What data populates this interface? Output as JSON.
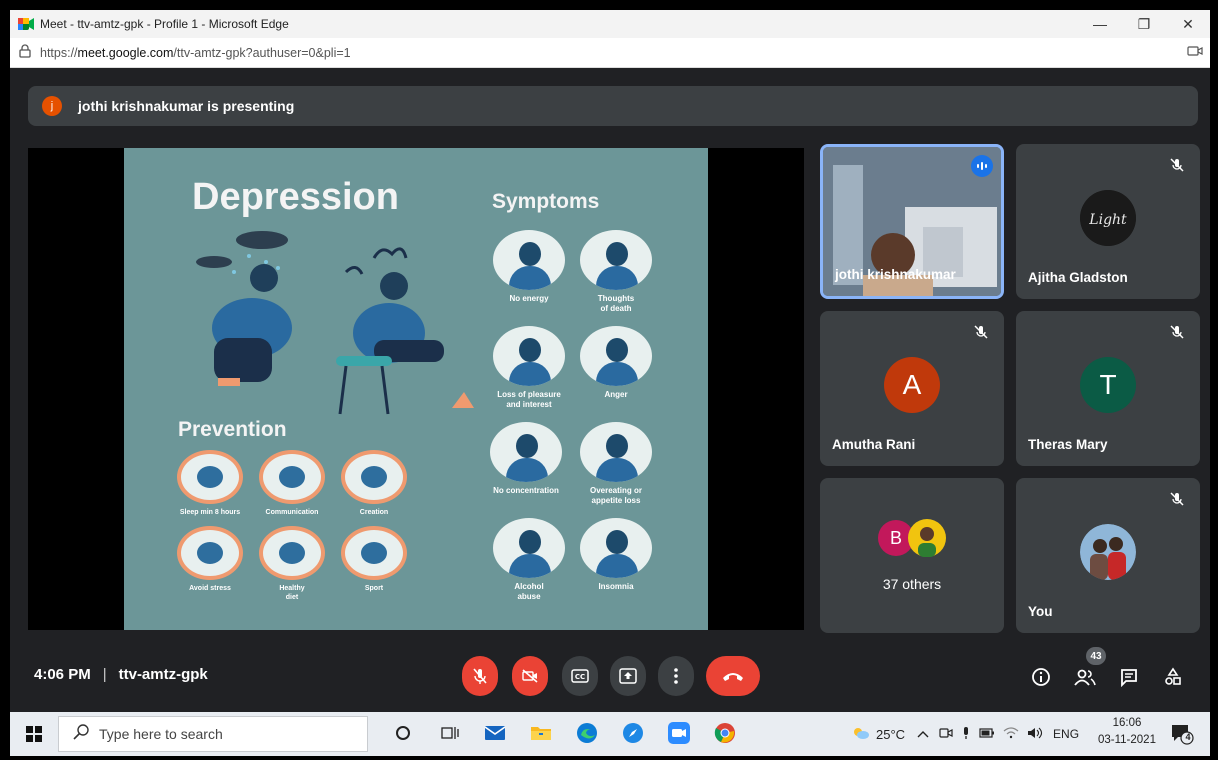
{
  "browser": {
    "title": "Meet - ttv-amtz-gpk - Profile 1 - Microsoft Edge",
    "url_prefix": "https://",
    "url_host": "meet.google.com",
    "url_path": "/ttv-amtz-gpk?authuser=0&pli=1"
  },
  "presenting": {
    "avatar_letter": "j",
    "text": "jothi krishnakumar is presenting"
  },
  "slide": {
    "title": "Depression",
    "symptoms_heading": "Symptoms",
    "prevention_heading": "Prevention",
    "symptoms": [
      {
        "line1": "No energy",
        "line2": ""
      },
      {
        "line1": "Thoughts",
        "line2": "of death"
      },
      {
        "line1": "Loss of pleasure",
        "line2": "and interest"
      },
      {
        "line1": "Anger",
        "line2": ""
      },
      {
        "line1": "No concentration",
        "line2": ""
      },
      {
        "line1": "Overeating or",
        "line2": "appetite loss"
      },
      {
        "line1": "Alcohol",
        "line2": "abuse"
      },
      {
        "line1": "Insomnia",
        "line2": ""
      }
    ],
    "prevention": [
      {
        "line1": "Sleep min 8 hours",
        "line2": ""
      },
      {
        "line1": "Communication",
        "line2": ""
      },
      {
        "line1": "Creation",
        "line2": ""
      },
      {
        "line1": "Avoid stress",
        "line2": ""
      },
      {
        "line1": "Healthy",
        "line2": "diet"
      },
      {
        "line1": "Sport",
        "line2": ""
      }
    ]
  },
  "participants": {
    "presenter": {
      "name": "jothi krishnakumar"
    },
    "ajitha": {
      "name": "Ajitha Gladston"
    },
    "amutha": {
      "name": "Amutha Rani",
      "initial": "A",
      "color": "#c0390b"
    },
    "theras": {
      "name": "Theras Mary",
      "initial": "T",
      "color": "#0b5b45"
    },
    "others": {
      "label": "37 others",
      "initial": "B",
      "color": "#c2185b"
    },
    "you": {
      "name": "You"
    }
  },
  "meeting": {
    "time": "4:06 PM",
    "separator": "|",
    "code": "ttv-amtz-gpk",
    "participant_count": "43"
  },
  "taskbar": {
    "search_placeholder": "Type here to search",
    "temperature": "25°C",
    "language": "ENG",
    "time": "16:06",
    "date": "03-11-2021",
    "notification_count": "4"
  },
  "colors": {
    "meet_bg": "#202124",
    "tile_bg": "#3c4043",
    "red": "#ea4335",
    "slide_bg": "#6c9698"
  }
}
